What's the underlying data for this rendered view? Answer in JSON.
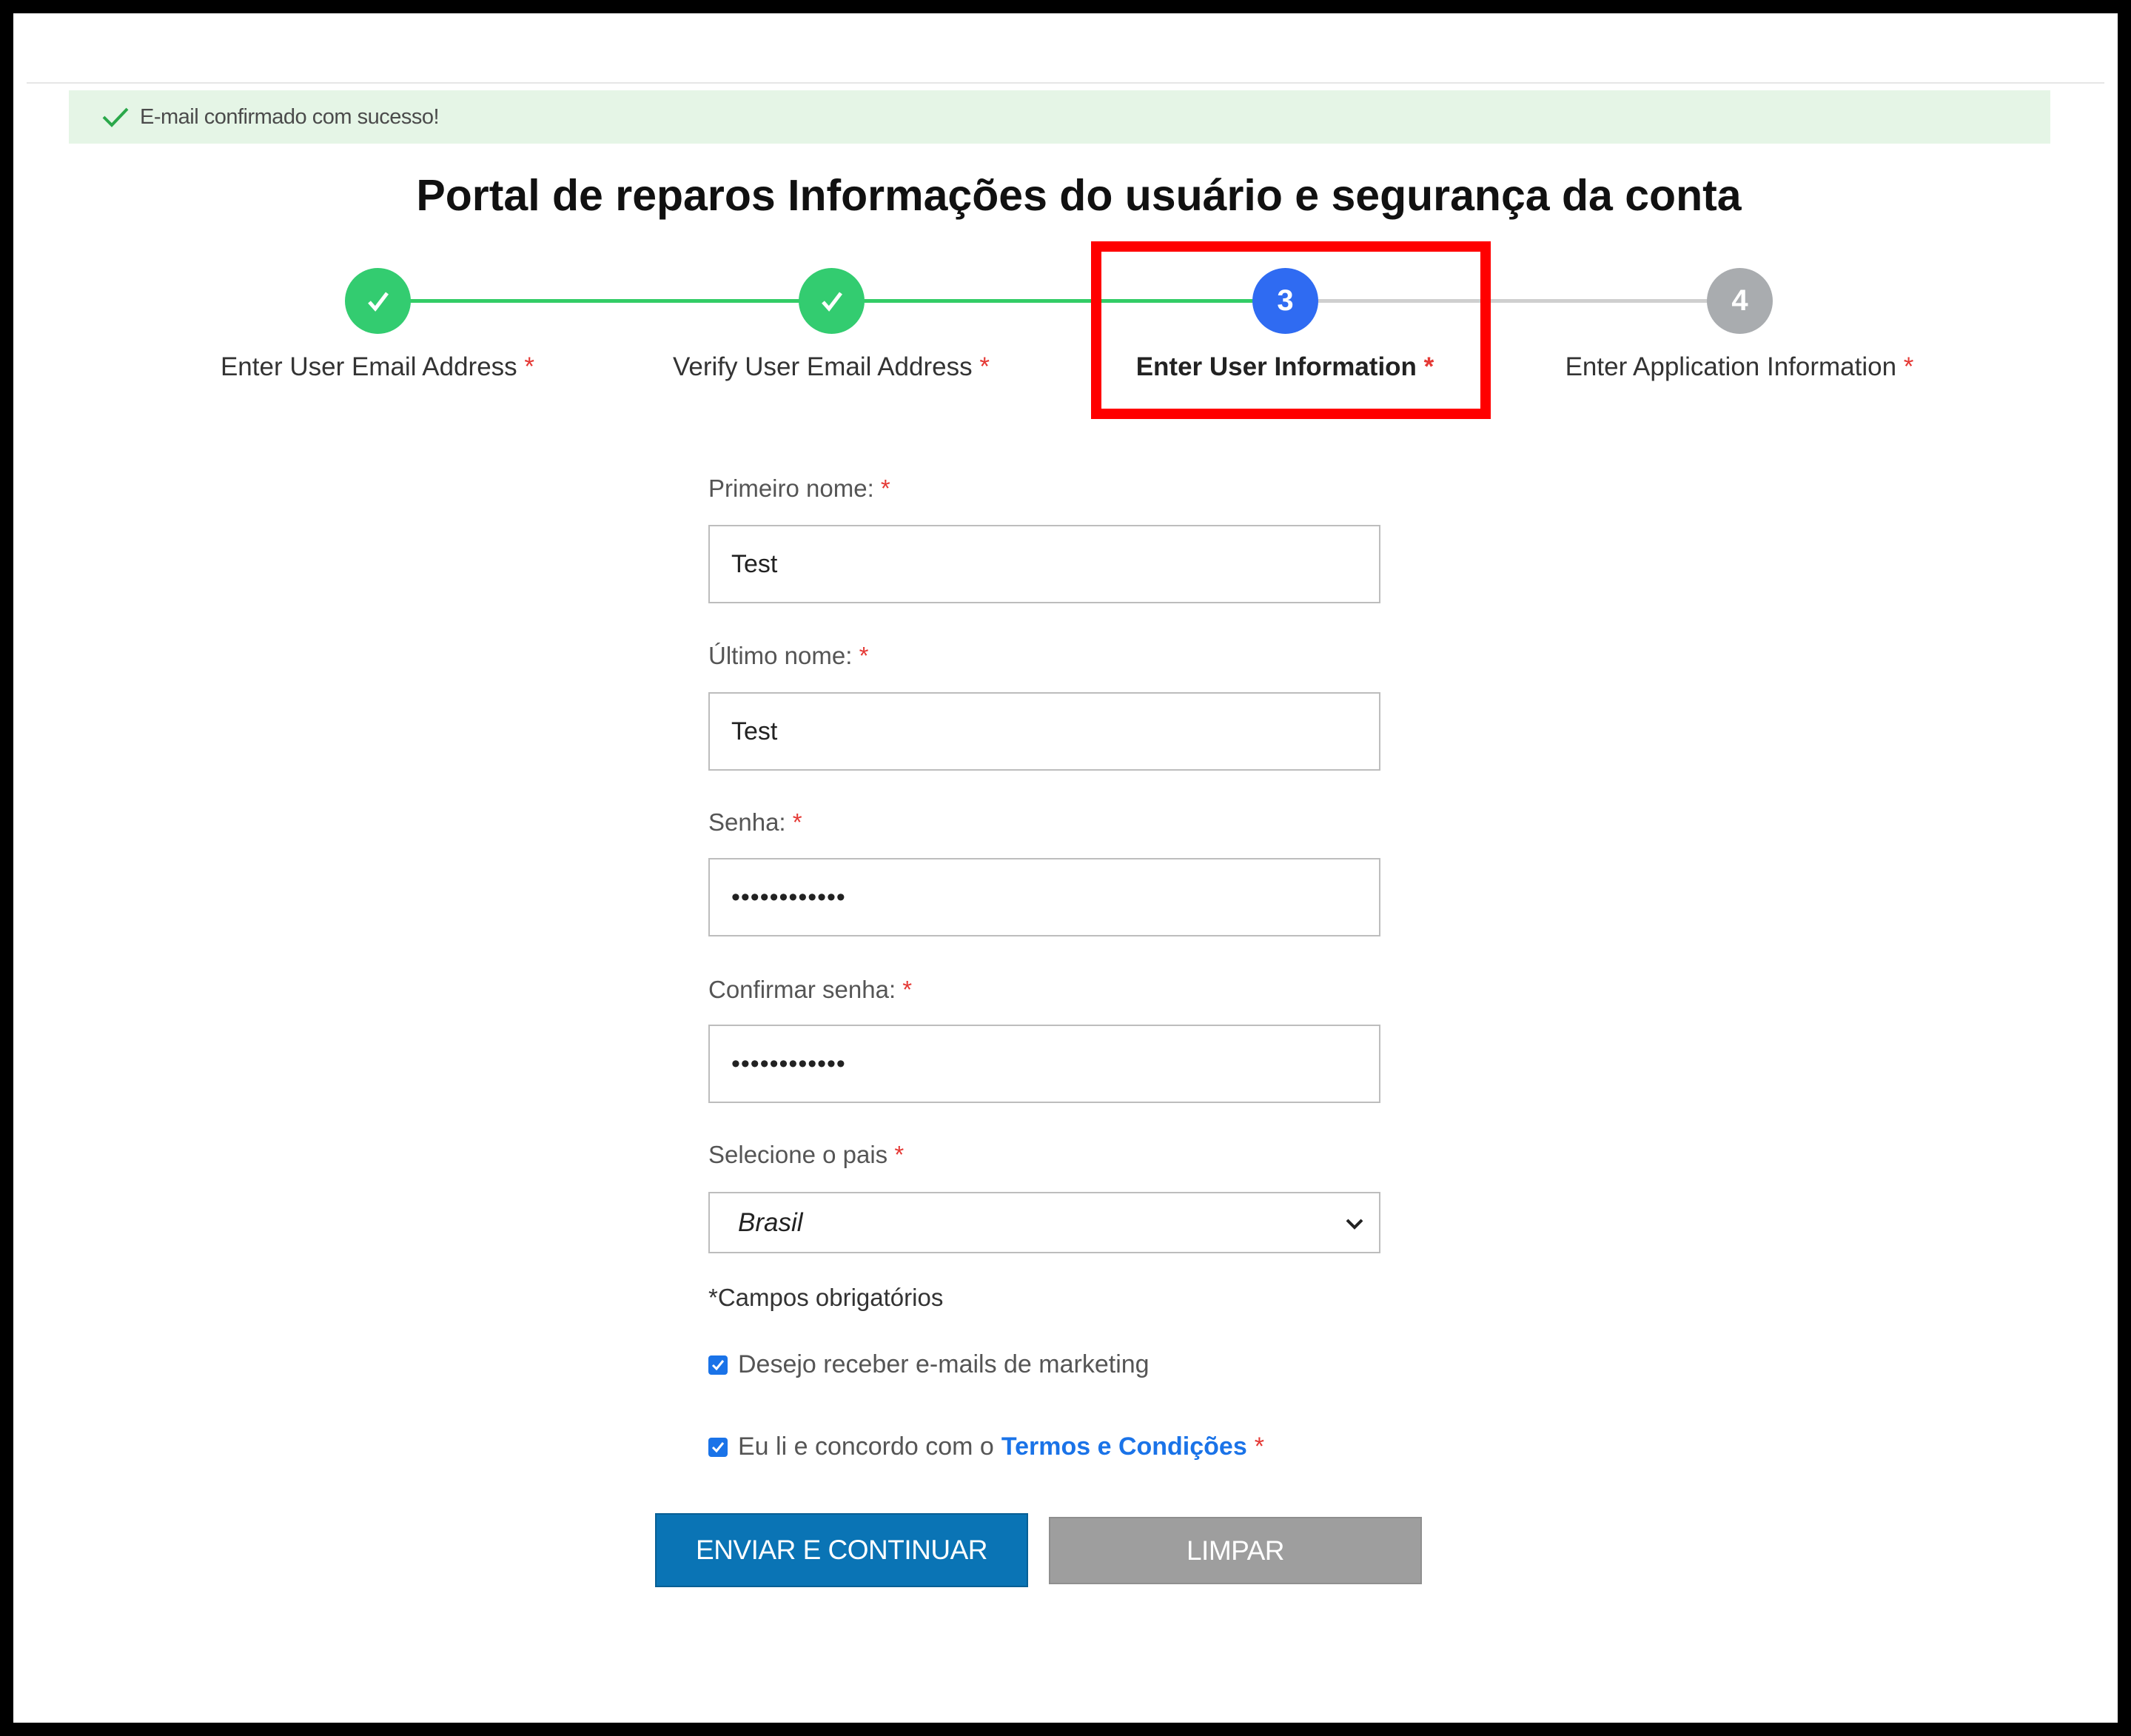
{
  "banner": {
    "message": "E-mail confirmado com sucesso!"
  },
  "page_title": "Portal de reparos Informações do usuário e segurança da conta",
  "stepper": {
    "steps": [
      {
        "label": "Enter User Email Address",
        "number": "1",
        "state": "done"
      },
      {
        "label": "Verify User Email Address",
        "number": "2",
        "state": "done"
      },
      {
        "label": "Enter User Information",
        "number": "3",
        "state": "active"
      },
      {
        "label": "Enter Application Information",
        "number": "4",
        "state": "todo"
      }
    ],
    "required_mark": "*"
  },
  "form": {
    "first_name": {
      "label": "Primeiro nome:",
      "value": "Test"
    },
    "last_name": {
      "label": "Último nome:",
      "value": "Test"
    },
    "password": {
      "label": "Senha:",
      "value": "••••••••••••"
    },
    "confirm_password": {
      "label": "Confirmar senha:",
      "value": "••••••••••••"
    },
    "country": {
      "label": "Selecione o pais",
      "value": "Brasil"
    },
    "required_note": "*Campos obrigatórios",
    "marketing": {
      "label": "Desejo receber e-mails de marketing",
      "checked": true
    },
    "terms": {
      "label": "Eu li e concordo com o",
      "link": "Termos e Condições",
      "checked": true
    }
  },
  "buttons": {
    "submit": "ENVIAR E CONTINUAR",
    "clear": "LIMPAR"
  },
  "colors": {
    "accent": "#0a74b5",
    "success": "#33cc70",
    "active_step": "#2f6bf2",
    "highlight": "#ff0000"
  }
}
